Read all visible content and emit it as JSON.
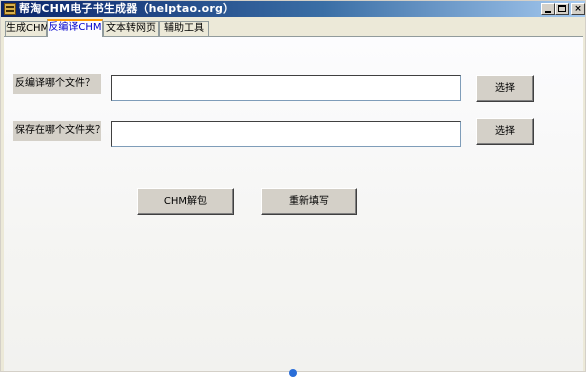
{
  "window": {
    "title": "帮淘CHM电子书生成器（helptao.org）",
    "icon": "book-app-icon",
    "controls": {
      "minimize": "minimize-icon",
      "maximize": "maximize-icon",
      "close_label": "×"
    }
  },
  "tabs": [
    {
      "label": "生成CHM",
      "active": false
    },
    {
      "label": "反编译CHM",
      "active": true
    },
    {
      "label": "文本转网页",
      "active": false
    },
    {
      "label": "辅助工具",
      "active": false
    }
  ],
  "form": {
    "source_label": "反编译哪个文件？",
    "source_value": "",
    "source_choose_label": "选择",
    "target_label": "保存在哪个文件夹？",
    "target_value": "",
    "target_choose_label": "选择"
  },
  "actions": {
    "unpack_label": "CHM解包",
    "reset_label": "重新填写"
  },
  "colors": {
    "titlebar_start": "#0a246a",
    "titlebar_end": "#a6caf0",
    "active_tab_accent": "#ff9900",
    "active_tab_text": "#0000cc",
    "button_face": "#d4d0c8"
  }
}
